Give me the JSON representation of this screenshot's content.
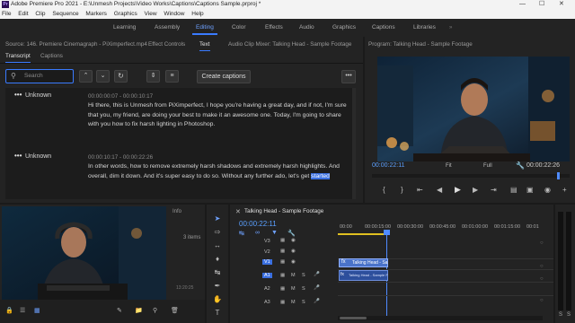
{
  "titlebar": {
    "app_icon": "Pr",
    "title": "Adobe Premiere Pro 2021 - E:\\Unmesh Projects\\Video Works\\Captions\\Captions Sample.prproj *",
    "controls": [
      "—",
      "☐",
      "✕"
    ]
  },
  "menu": [
    "File",
    "Edit",
    "Clip",
    "Sequence",
    "Markers",
    "Graphics",
    "View",
    "Window",
    "Help"
  ],
  "workspaces": {
    "items": [
      "Learning",
      "Assembly",
      "Editing",
      "Color",
      "Effects",
      "Audio",
      "Graphics",
      "Captions",
      "Libraries"
    ],
    "active": "Editing",
    "overflow": "»"
  },
  "source_panel": {
    "tabs": [
      "Source: 146. Premiere Cinemagraph - PiXimperfect.mp4",
      "Effect Controls",
      "Text",
      "Audio Clip Mixer: Talking Head - Sample Footage"
    ],
    "active_tab": "Text",
    "subtabs": [
      "Transcript",
      "Captions"
    ],
    "active_subtab": "Transcript",
    "search_placeholder": "Search",
    "create_captions_label": "Create captions",
    "more_label": "•••",
    "entries": [
      {
        "speaker": "Unknown",
        "timecode": "00:00:00:07 - 00:00:10:17",
        "text_before": "Hi there, this is Unmesh from PiXimperfect, I hope you're having a great day, and if not, I'm sure that you, my friend, are doing your best to make it an awesome one. Today, I'm going to share with you how to fix harsh lighting in Photoshop.",
        "highlight": ""
      },
      {
        "speaker": "Unknown",
        "timecode": "00:00:10:17 - 00:00:22:26",
        "text_before": "In other words, how to remove extremely harsh shadows and extremely harsh highlights. And overall, dim it down. And it's super easy to do so. Without any further ado, let's get ",
        "highlight": "started"
      }
    ]
  },
  "program_monitor": {
    "title": "Program: Talking Head - Sample Footage",
    "timecode": "00:00:22:11",
    "fit": "Fit",
    "quality": "Full",
    "duration": "00:00:22:26"
  },
  "project_panel": {
    "tab": "Info",
    "item_count": "3 items"
  },
  "timeline": {
    "sequence_title": "Talking Head - Sample Footage",
    "timecode": "00:00:22:11",
    "ruler": [
      "00:00",
      "00:00:15:00",
      "00:00:30:00",
      "00:00:45:00",
      "00:01:00:00",
      "00:01:15:00",
      "00:01"
    ],
    "video_tracks": [
      "V3",
      "V2",
      "V1"
    ],
    "audio_tracks": [
      "A1",
      "A2",
      "A3"
    ],
    "track_controls": [
      "M",
      "S"
    ],
    "clip_name": "Talking Head - Sa",
    "audio_clip_name": "Talking Head - Sample Footage"
  },
  "colors": {
    "accent": "#3a7bff",
    "highlight": "#3a6fe0",
    "timecode": "#5aa0ff",
    "playhead": "#4f8bff",
    "clip_video": "#4a73c9",
    "clip_audio": "#2d4f9c"
  },
  "icons": [
    "search-icon",
    "chevron-up-icon",
    "chevron-down-icon",
    "refresh-icon",
    "split-icon",
    "merge-icon",
    "wrench-icon",
    "play-icon",
    "step-back-icon",
    "step-forward-icon",
    "selection-tool-icon",
    "hand-tool-icon",
    "pen-tool-icon",
    "type-tool-icon",
    "razor-tool-icon"
  ]
}
